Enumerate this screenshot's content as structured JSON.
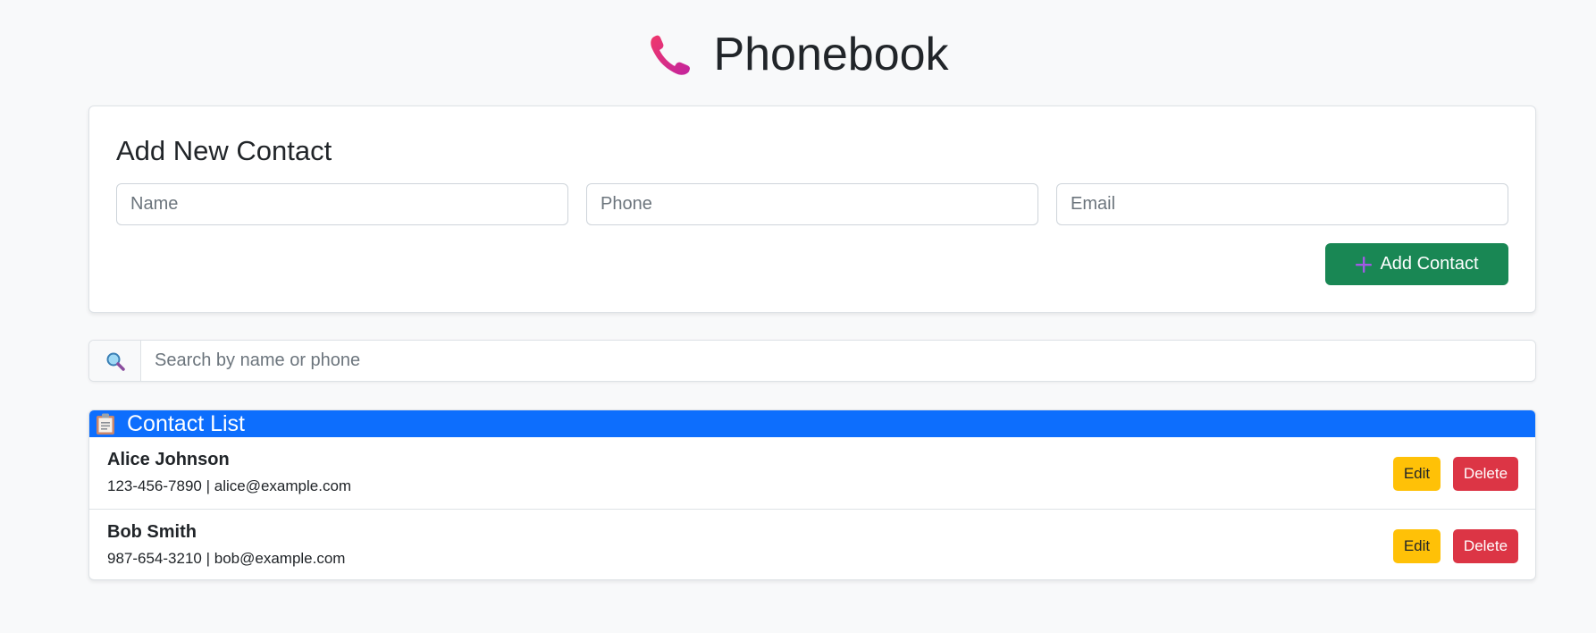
{
  "header": {
    "title": "Phonebook",
    "icon": "telephone-receiver-icon"
  },
  "add_form": {
    "heading": "Add New Contact",
    "name_placeholder": "Name",
    "phone_placeholder": "Phone",
    "email_placeholder": "Email",
    "name_value": "",
    "phone_value": "",
    "email_value": "",
    "submit_label": "Add Contact",
    "submit_icon": "plus-icon"
  },
  "search": {
    "icon": "magnifying-glass-icon",
    "placeholder": "Search by name or phone",
    "value": ""
  },
  "contact_list": {
    "heading": "Contact List",
    "icon": "clipboard-icon",
    "contacts": [
      {
        "name": "Alice Johnson",
        "phone": "123-456-7890",
        "separator": " | ",
        "email": "alice@example.com",
        "edit_label": "Edit",
        "delete_label": "Delete"
      },
      {
        "name": "Bob Smith",
        "phone": "987-654-3210",
        "separator": " | ",
        "email": "bob@example.com",
        "edit_label": "Edit",
        "delete_label": "Delete"
      }
    ]
  },
  "colors": {
    "page_bg": "#f8f9fa",
    "primary": "#0d6efd",
    "success": "#198754",
    "warning": "#ffc107",
    "danger": "#dc3545",
    "phone_icon": "#e8306d",
    "plus_icon": "#a259e6"
  }
}
